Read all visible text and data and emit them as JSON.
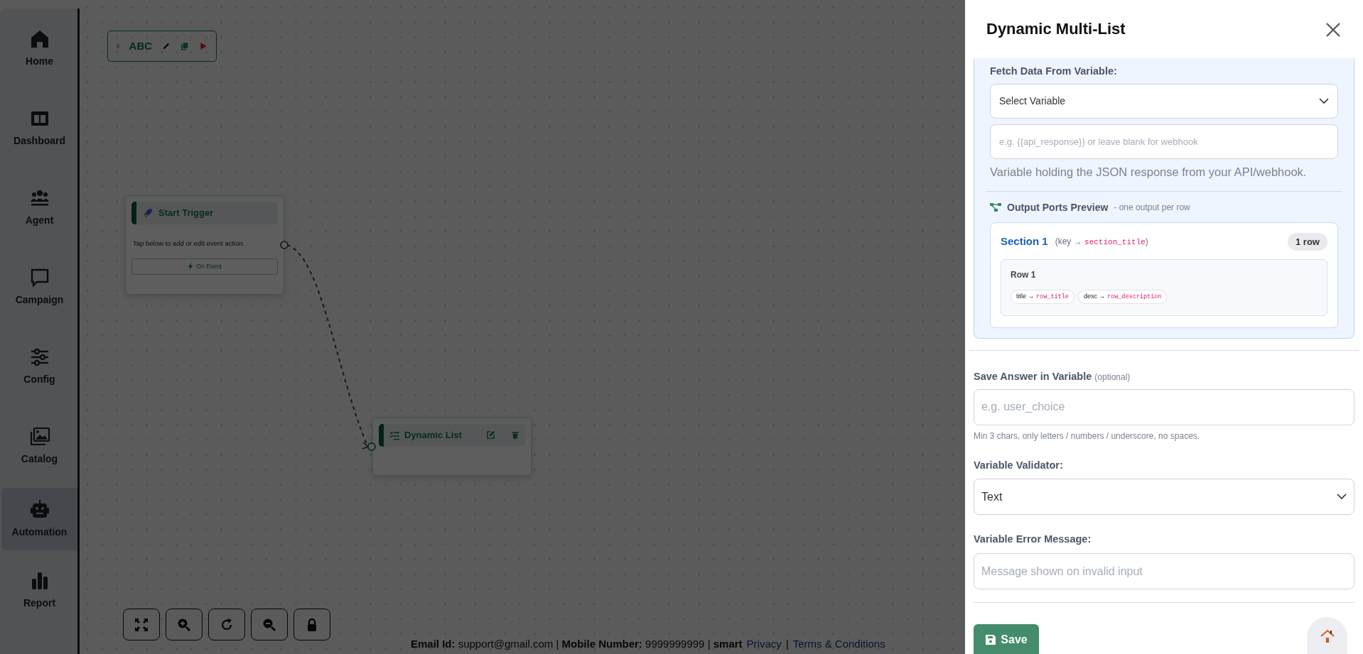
{
  "sidebar": {
    "items": [
      {
        "label": "Home",
        "selected": false
      },
      {
        "label": "Dashboard",
        "selected": false
      },
      {
        "label": "Agent",
        "selected": false
      },
      {
        "label": "Campaign",
        "selected": false
      },
      {
        "label": "Config",
        "selected": false
      },
      {
        "label": "Catalog",
        "selected": false
      },
      {
        "label": "Automation",
        "selected": true
      },
      {
        "label": "Report",
        "selected": false
      }
    ]
  },
  "canvas": {
    "toolbar": {
      "label": "ABC"
    },
    "nodes": [
      {
        "kind": "trigger",
        "title": "Start Trigger",
        "text": "Tap below to add or edit event action.",
        "button": "On Event"
      },
      {
        "kind": "list",
        "title": "Dynamic List"
      }
    ]
  },
  "footer": {
    "contact": "**Email Id:** support@gmail.com | **Mobile Number:** 9999999999 | **smart**",
    "links": [
      "Privacy",
      "|",
      "Terms & Conditions"
    ]
  },
  "panel": {
    "title": "Dynamic Multi-List",
    "fetch": {
      "label": "Fetch Data From Variable:",
      "select": "Select Variable",
      "placeholder": "e.g. {{api_response}} or leave blank for webhook",
      "help": "Variable holding the JSON response from your API/webhook."
    },
    "preview": {
      "title": "Output Ports Preview",
      "subtitle": "- one output per row",
      "sections": [
        {
          "title": "Section 1",
          "key_prefix": "(key → ",
          "key": "section_title",
          "key_suffix": ")",
          "count": "1 row",
          "rows": [
            {
              "title": "Row 1",
              "pills": [
                {
                  "label": "title → ",
                  "value": "row_title"
                },
                {
                  "label": "desc → ",
                  "value": "row_description"
                }
              ]
            }
          ]
        }
      ]
    },
    "save_var": {
      "label": "Save Answer in Variable",
      "optional": "(optional)",
      "placeholder": "e.g. user_choice",
      "hint": "Min 3 chars, only letters / numbers / underscore, no spaces."
    },
    "validator": {
      "label": "Variable Validator:",
      "value": "Text"
    },
    "error": {
      "label": "Variable Error Message:",
      "placeholder": "Message shown on invalid input"
    },
    "save_button": "Save"
  }
}
